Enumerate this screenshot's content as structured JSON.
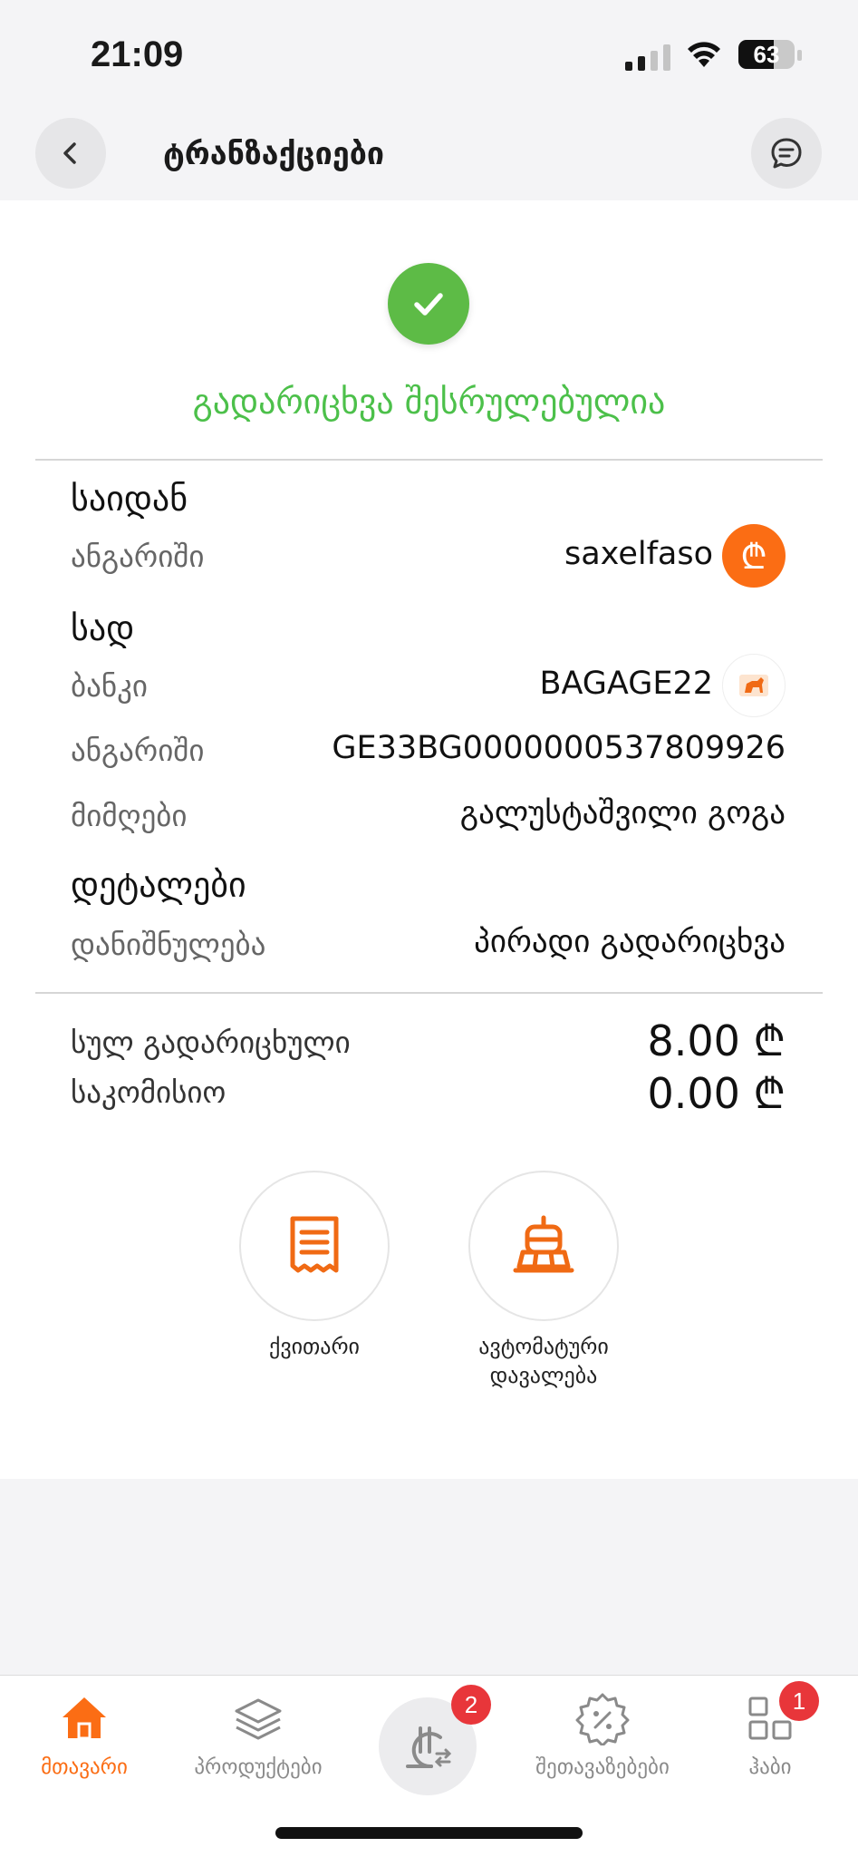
{
  "status_bar": {
    "time": "21:09",
    "battery": "63",
    "battery_level": 0.63
  },
  "header": {
    "title": "ტრანზაქციები"
  },
  "result": {
    "message": "გადარიცხვა შესრულებულია"
  },
  "from": {
    "heading": "საიდან",
    "account_label": "ანგარიში",
    "account_value": "saxelfaso",
    "account_badge": "₾"
  },
  "to": {
    "heading": "სად",
    "bank_label": "ბანკი",
    "bank_value": "BAGAGE22",
    "account_label": "ანგარიში",
    "account_value": "GE33BG0000000537809926",
    "recipient_label": "მიმღები",
    "recipient_value": "გალუსტაშვილი გოგა"
  },
  "details": {
    "heading": "დეტალები",
    "purpose_label": "დანიშნულება",
    "purpose_value": "პირადი გადარიცხვა"
  },
  "totals": {
    "total_label": "სულ გადარიცხული",
    "total_value": "8.00 ₾",
    "fee_label": "საკომისიო",
    "fee_value": "0.00 ₾"
  },
  "actions": {
    "receipt_label": "ქვითარი",
    "auto_task_label_1": "ავტომატური",
    "auto_task_label_2": "დავალება"
  },
  "nav": {
    "items": [
      {
        "label": "მთავარი",
        "icon": "home-icon"
      },
      {
        "label": "პროდუქტები",
        "icon": "layers-icon"
      },
      {
        "label": "",
        "icon": "lari-transfer-icon",
        "badge": "2"
      },
      {
        "label": "შეთავაზებები",
        "icon": "discount-icon"
      },
      {
        "label": "ჰაბი",
        "icon": "apps-icon",
        "badge": "1"
      }
    ]
  },
  "colors": {
    "accent": "#fb6d14",
    "success": "#5dbb46",
    "badge": "#e8363a"
  }
}
